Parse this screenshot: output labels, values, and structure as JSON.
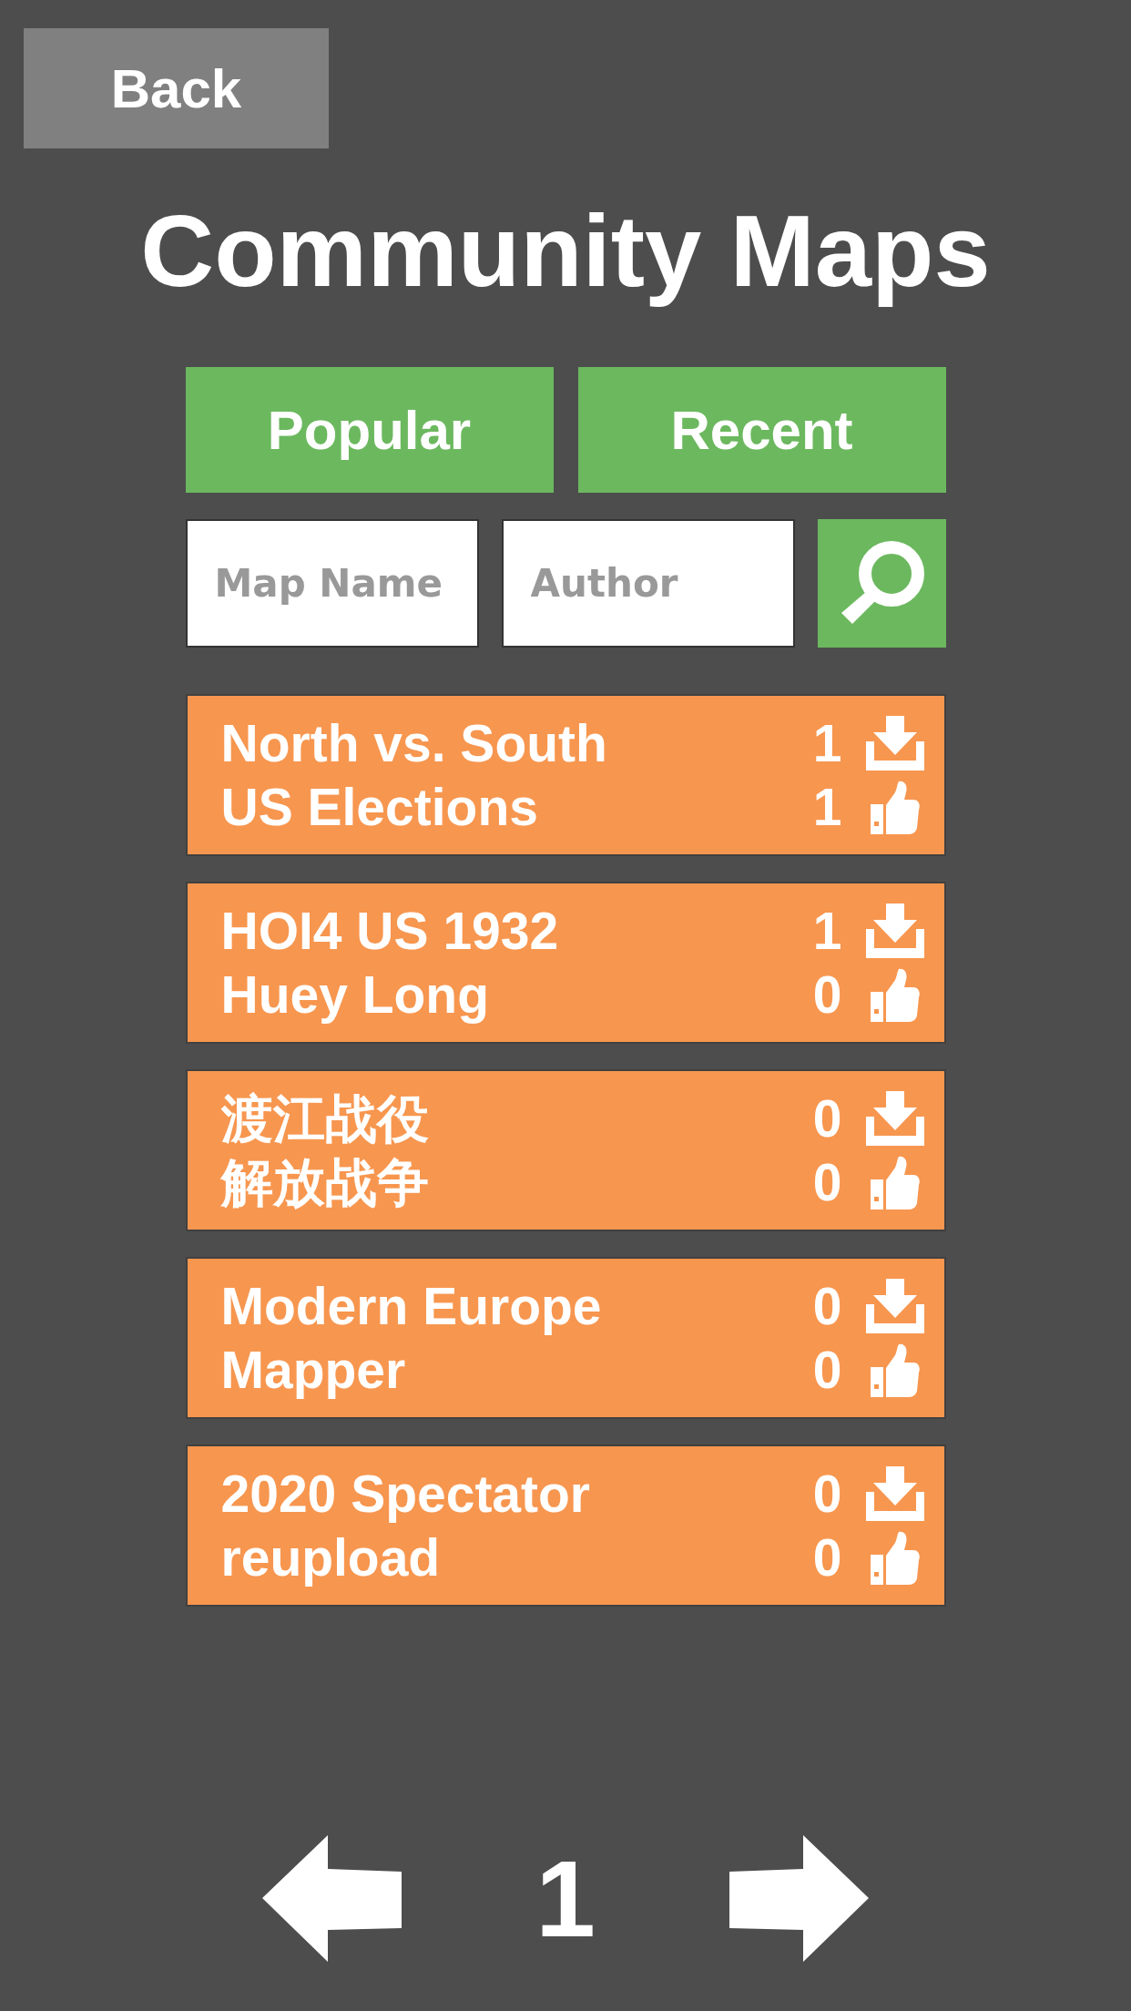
{
  "back_button": {
    "label": "Back"
  },
  "title": "Community Maps",
  "sort_buttons": [
    {
      "label": "Popular"
    },
    {
      "label": "Recent"
    }
  ],
  "search": {
    "fields": [
      {
        "placeholder": "Map Name"
      },
      {
        "placeholder": "Author"
      }
    ]
  },
  "maps": [
    {
      "name_lines": [
        "North vs. South",
        "US Elections"
      ],
      "downloads": "1",
      "likes": "1"
    },
    {
      "name_lines": [
        "HOI4 US 1932",
        "Huey Long"
      ],
      "downloads": "1",
      "likes": "0"
    },
    {
      "name_lines": [
        "渡江战役",
        "解放战争"
      ],
      "downloads": "0",
      "likes": "0"
    },
    {
      "name_lines": [
        "Modern Europe",
        "Mapper"
      ],
      "downloads": "0",
      "likes": "0"
    },
    {
      "name_lines": [
        "2020 Spectator",
        "reupload"
      ],
      "downloads": "0",
      "likes": "0"
    }
  ],
  "pagination": {
    "page": "1"
  }
}
